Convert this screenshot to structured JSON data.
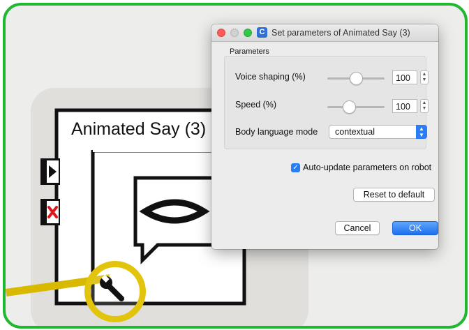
{
  "box": {
    "title": "Animated Say (3)"
  },
  "icons": {
    "play": "play-icon",
    "delete": "close-icon",
    "speech": "speech-bubble-icon",
    "wrench": "wrench-icon"
  },
  "dialog": {
    "title": "Set parameters of Animated Say (3)",
    "app_icon_letter": "C",
    "group_label": "Parameters",
    "voice_shaping": {
      "label": "Voice shaping (%)",
      "value": "100",
      "slider_fraction": 0.5
    },
    "speed": {
      "label": "Speed (%)",
      "value": "100",
      "slider_fraction": 0.38
    },
    "body_language": {
      "label": "Body language mode",
      "selected": "contextual"
    },
    "auto_update": {
      "label": "Auto-update parameters on robot",
      "checked": true
    },
    "reset_label": "Reset to default",
    "cancel_label": "Cancel",
    "ok_label": "OK"
  },
  "colors": {
    "frame": "#20b832",
    "highlight": "#e3c40c",
    "accent": "#2a7cf7",
    "close": "#fc5b57",
    "maximize": "#33c748"
  }
}
